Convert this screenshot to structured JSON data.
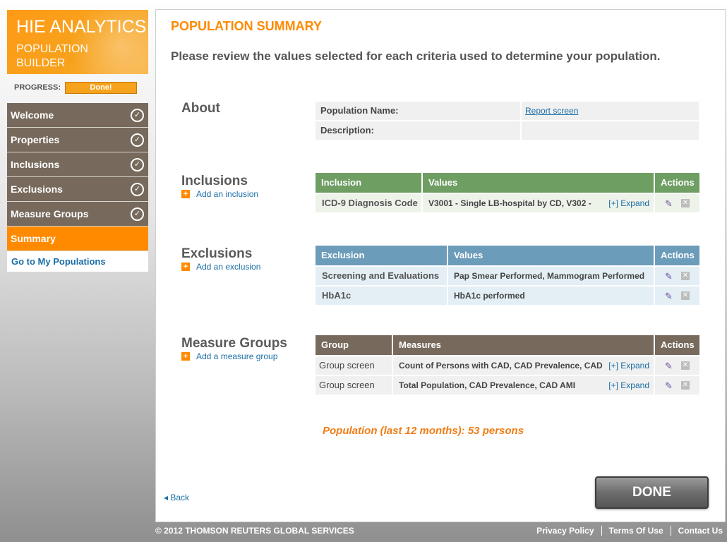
{
  "brand": {
    "title": "HIE ANALYTICS",
    "subtitle": "POPULATION BUILDER"
  },
  "progress": {
    "label": "PROGRESS:",
    "status": "Done!"
  },
  "nav": {
    "items": [
      {
        "label": "Welcome",
        "completed": true
      },
      {
        "label": "Properties",
        "completed": true
      },
      {
        "label": "Inclusions",
        "completed": true
      },
      {
        "label": "Exclusions",
        "completed": true
      },
      {
        "label": "Measure Groups",
        "completed": true
      },
      {
        "label": "Summary",
        "active": true
      }
    ],
    "link": "Go to My Populations"
  },
  "page": {
    "title": "POPULATION SUMMARY",
    "intro": "Please review the values selected for each criteria used to determine your population."
  },
  "about": {
    "title": "About",
    "rows": [
      {
        "key": "Population Name:",
        "value": "Report screen"
      },
      {
        "key": "Description:",
        "value": ""
      }
    ]
  },
  "inclusions": {
    "title": "Inclusions",
    "add_label": "Add an inclusion",
    "headers": [
      "Inclusion",
      "Values",
      "Actions"
    ],
    "rows": [
      {
        "name": "ICD-9 Diagnosis Code",
        "values": "V3001 - Single LB-hospital by CD, V302 -",
        "expand": "[+] Expand"
      }
    ]
  },
  "exclusions": {
    "title": "Exclusions",
    "add_label": "Add an exclusion",
    "headers": [
      "Exclusion",
      "Values",
      "Actions"
    ],
    "rows": [
      {
        "name": "Screening and Evaluations",
        "values": "Pap Smear Performed, Mammogram Performed"
      },
      {
        "name": "HbA1c",
        "values": "HbA1c performed"
      }
    ]
  },
  "measure_groups": {
    "title": "Measure Groups",
    "add_label": "Add a measure group",
    "headers": [
      "Group",
      "Measures",
      "Actions"
    ],
    "rows": [
      {
        "name": "Group screen",
        "values": "Count of Persons with CAD, CAD Prevalence, CAD",
        "expand": "[+] Expand"
      },
      {
        "name": "Group screen",
        "values": "Total Population, CAD Prevalence, CAD AMI",
        "expand": "[+] Expand"
      }
    ]
  },
  "population_summary": "Population (last 12 months): 53 persons",
  "back_label": "Back",
  "done_label": "DONE",
  "footer": {
    "copyright": "© 2012 THOMSON REUTERS GLOBAL SERVICES",
    "links": [
      "Privacy Policy",
      "Terms Of Use",
      "Contact Us"
    ]
  },
  "colors": {
    "accent": "#ff8a00",
    "nav_bg": "#776a5c",
    "inclusion_header": "#6f9e63",
    "exclusion_header": "#6b9cb9",
    "link": "#1a6ea5"
  }
}
